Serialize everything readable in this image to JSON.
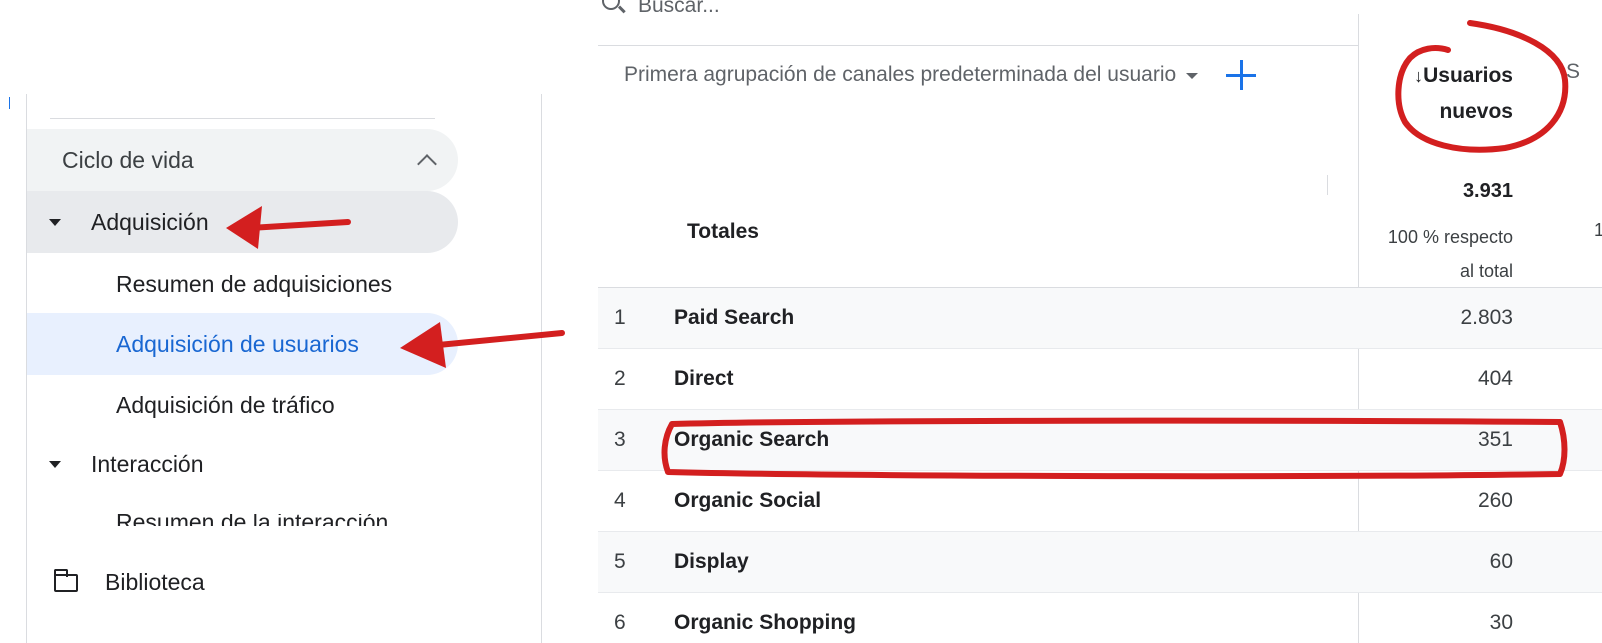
{
  "sidebar": {
    "section_title": "Ciclo de vida",
    "groups": [
      {
        "label": "Adquisición",
        "items": [
          "Resumen de adquisiciones",
          "Adquisición de usuarios",
          "Adquisición de tráfico"
        ]
      },
      {
        "label": "Interacción",
        "items": [
          "Resumen de la interacción"
        ]
      }
    ],
    "selected_item": "Adquisición de usuarios",
    "footer_label": "Biblioteca",
    "footer_icon": "folder-icon"
  },
  "search": {
    "placeholder": "Buscar..."
  },
  "table": {
    "dimension_header": "Primera agrupación de canales predeterminada del usuario",
    "metric_header_line1": "Usuarios",
    "metric_header_line2": "nuevos",
    "sort_arrow": "↓",
    "next_column_letter": "S",
    "totals": {
      "label": "Totales",
      "value": "3.931",
      "pct_line1": "100 % respecto",
      "pct_line2": "al total",
      "clipped_next": "1"
    },
    "rows": [
      {
        "index": "1",
        "channel": "Paid Search",
        "value": "2.803"
      },
      {
        "index": "2",
        "channel": "Direct",
        "value": "404"
      },
      {
        "index": "3",
        "channel": "Organic Search",
        "value": "351"
      },
      {
        "index": "4",
        "channel": "Organic Social",
        "value": "260"
      },
      {
        "index": "5",
        "channel": "Display",
        "value": "60"
      },
      {
        "index": "6",
        "channel": "Organic Shopping",
        "value": "30"
      }
    ]
  },
  "colors": {
    "accent": "#1a73e8",
    "selected_bg": "#e8f0fe",
    "annotation_red": "#d31f1f"
  }
}
